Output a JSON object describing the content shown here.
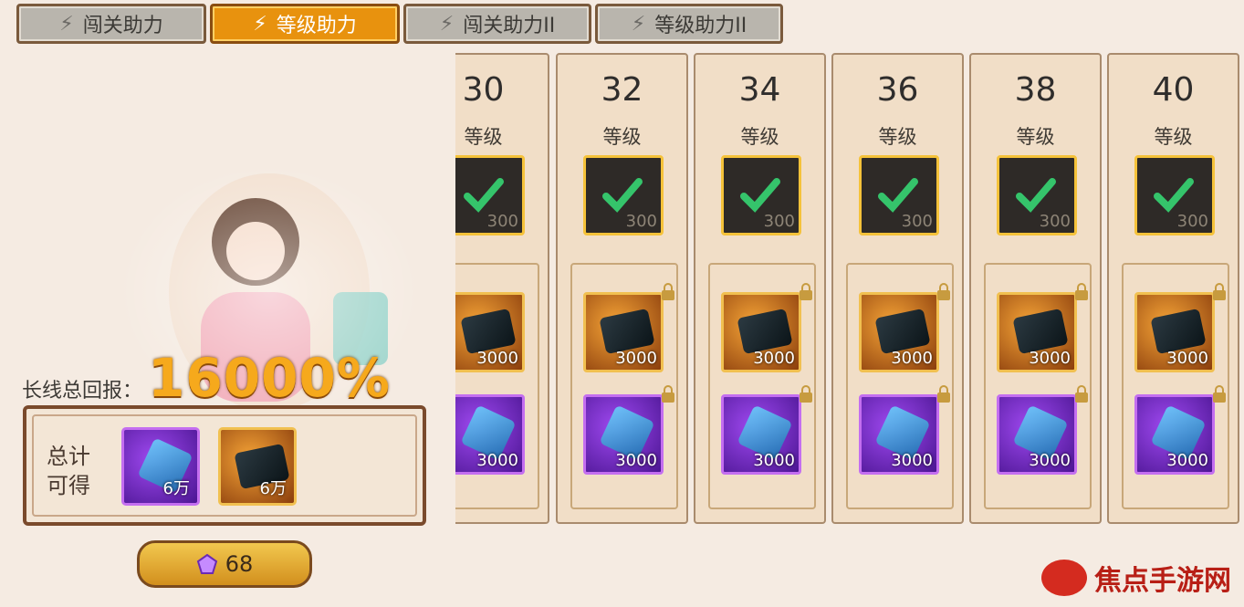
{
  "tabs": [
    {
      "label": "闯关助力",
      "active": false
    },
    {
      "label": "等级助力",
      "active": true
    },
    {
      "label": "闯关助力II",
      "active": false
    },
    {
      "label": "等级助力II",
      "active": false
    }
  ],
  "left_panel": {
    "return_label": "长线总回报：",
    "return_value": "16000%",
    "total_label": "总计\n可得",
    "totals": [
      {
        "icon": "blue-crystal-icon",
        "qty": "6万"
      },
      {
        "icon": "dark-ore-icon",
        "qty": "6万"
      }
    ],
    "currency_amount": "68",
    "currency_icon": "gem-icon"
  },
  "levels": [
    {
      "level": "30",
      "label": "等级",
      "claimed_value": "300",
      "reward1": "3000",
      "reward2": "3000"
    },
    {
      "level": "32",
      "label": "等级",
      "claimed_value": "300",
      "reward1": "3000",
      "reward2": "3000"
    },
    {
      "level": "34",
      "label": "等级",
      "claimed_value": "300",
      "reward1": "3000",
      "reward2": "3000"
    },
    {
      "level": "36",
      "label": "等级",
      "claimed_value": "300",
      "reward1": "3000",
      "reward2": "3000"
    },
    {
      "level": "38",
      "label": "等级",
      "claimed_value": "300",
      "reward1": "3000",
      "reward2": "3000"
    },
    {
      "level": "40",
      "label": "等级",
      "claimed_value": "300",
      "reward1": "3000",
      "reward2": "3000"
    }
  ],
  "watermark": {
    "text": "焦点手游网"
  },
  "colors": {
    "accent": "#e8920e",
    "frame": "#7a4a2c",
    "check": "#35c46b"
  }
}
